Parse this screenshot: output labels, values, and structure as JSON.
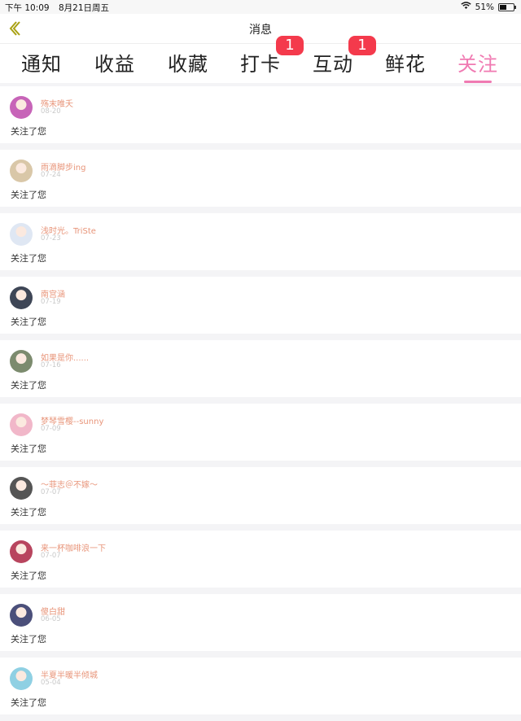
{
  "status_bar": {
    "time": "下午 10:09",
    "date": "8月21日周五",
    "battery": "51%",
    "battery_level": 0.51
  },
  "header": {
    "title": "消息",
    "back_icon": "chevron-left-icon"
  },
  "tabs": [
    {
      "label": "通知",
      "badge": ""
    },
    {
      "label": "收益",
      "badge": ""
    },
    {
      "label": "收藏",
      "badge": ""
    },
    {
      "label": "打卡",
      "badge": "1"
    },
    {
      "label": "互动",
      "badge": "1"
    },
    {
      "label": "鲜花",
      "badge": ""
    },
    {
      "label": "关注",
      "badge": "",
      "active": true
    }
  ],
  "colors": {
    "accent": "#f07ab2",
    "badge": "#f43a4c",
    "username": "#e8957a"
  },
  "notifications": [
    {
      "user": "殇末唯夭",
      "date": "08-20",
      "action": "关注了您",
      "avatar": "#c764b8"
    },
    {
      "user": "雨滴脚步ing",
      "date": "07-24",
      "action": "关注了您",
      "avatar": "#d9c7a8"
    },
    {
      "user": "浅时光。TriSte",
      "date": "07-23",
      "action": "关注了您",
      "avatar": "#dfe7f3"
    },
    {
      "user": "南宫涵",
      "date": "07-19",
      "action": "关注了您",
      "avatar": "#3e4656"
    },
    {
      "user": "如果是你......",
      "date": "07-16",
      "action": "关注了您",
      "avatar": "#7c8b6e"
    },
    {
      "user": "梦琴雪樱--sunny",
      "date": "07-09",
      "action": "关注了您",
      "avatar": "#f1b7c9"
    },
    {
      "user": "～菲志＠不嫁～",
      "date": "07-07",
      "action": "关注了您",
      "avatar": "#555555"
    },
    {
      "user": "来一杯咖啡浪一下",
      "date": "07-07",
      "action": "关注了您",
      "avatar": "#b8455e"
    },
    {
      "user": "傻白甜",
      "date": "06-05",
      "action": "关注了您",
      "avatar": "#4b4f7a"
    },
    {
      "user": "半夏半暖半倾城",
      "date": "05-04",
      "action": "关注了您",
      "avatar": "#8fd0e3"
    }
  ]
}
